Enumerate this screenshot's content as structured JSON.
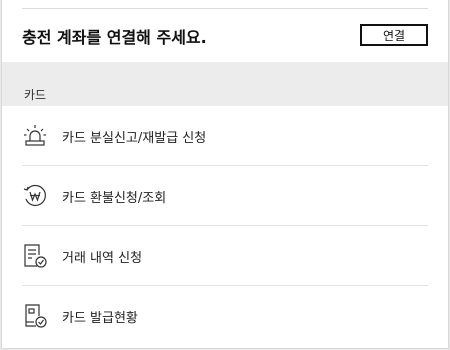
{
  "banner": {
    "title": "충전 계좌를 연결해 주세요.",
    "connect_label": "연결"
  },
  "section": {
    "label": "카드"
  },
  "menu": {
    "items": [
      {
        "label": "카드 분실신고/재발급 신청",
        "icon": "siren-icon"
      },
      {
        "label": "카드 환불신청/조회",
        "icon": "won-refund-icon"
      },
      {
        "label": "거래 내역 신청",
        "icon": "document-check-icon"
      },
      {
        "label": "카드 발급현황",
        "icon": "card-check-icon"
      }
    ]
  }
}
